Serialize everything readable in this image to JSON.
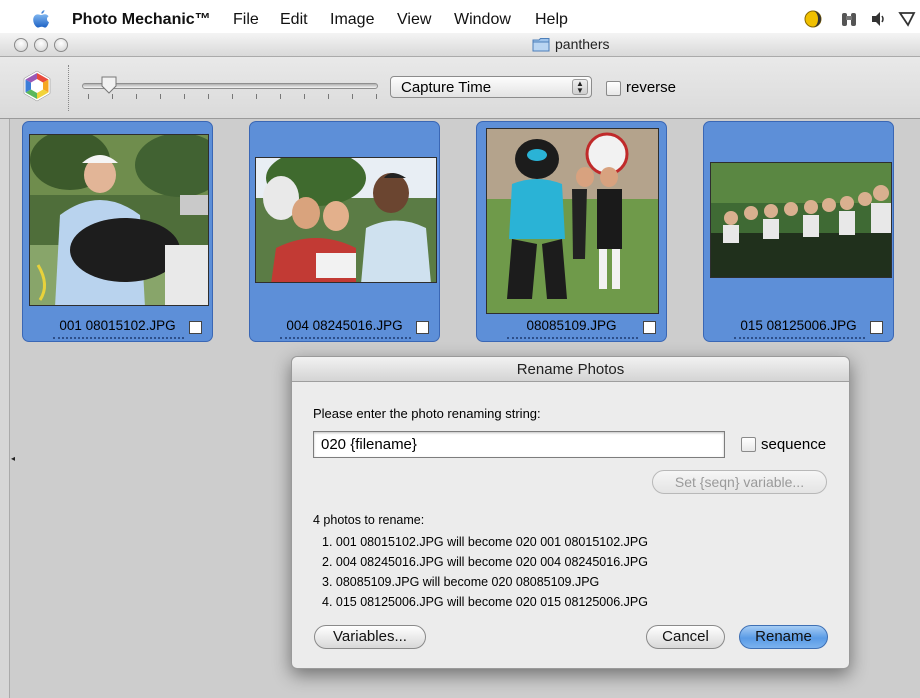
{
  "menubar": {
    "app_name": "Photo Mechanic™",
    "menus": [
      "File",
      "Edit",
      "Image",
      "View",
      "Window",
      "Help"
    ],
    "tray_icons": [
      "moon-icon",
      "binoculars-icon",
      "volume-icon",
      "flag-icon"
    ]
  },
  "window": {
    "title": "panthers",
    "title_icon": "folder-icon"
  },
  "toolbar": {
    "sort_select_value": "Capture Time",
    "reverse_label": "reverse",
    "reverse_checked": false
  },
  "thumbnails": [
    {
      "filename": "001 08015102.JPG",
      "selected": true
    },
    {
      "filename": "004 08245016.JPG",
      "selected": true
    },
    {
      "filename": "08085109.JPG",
      "selected": true
    },
    {
      "filename": "015 08125006.JPG",
      "selected": true
    }
  ],
  "dialog": {
    "title": "Rename Photos",
    "prompt": "Please enter the photo renaming string:",
    "rename_string": "020 {filename}",
    "sequence_label": "sequence",
    "set_seqn_button": "Set {seqn} variable...",
    "count_label": "4 photos to rename:",
    "items": [
      "1.  001 08015102.JPG will become 020 001 08015102.JPG",
      "2.  004 08245016.JPG will become 020 004 08245016.JPG",
      "3.  08085109.JPG will become 020 08085109.JPG",
      "4.  015 08125006.JPG will become 020 015 08125006.JPG"
    ],
    "variables_button": "Variables...",
    "cancel_button": "Cancel",
    "rename_button": "Rename"
  },
  "colors": {
    "selection_blue": "#5d8fd8",
    "default_button_blue": "#5a9be6"
  }
}
